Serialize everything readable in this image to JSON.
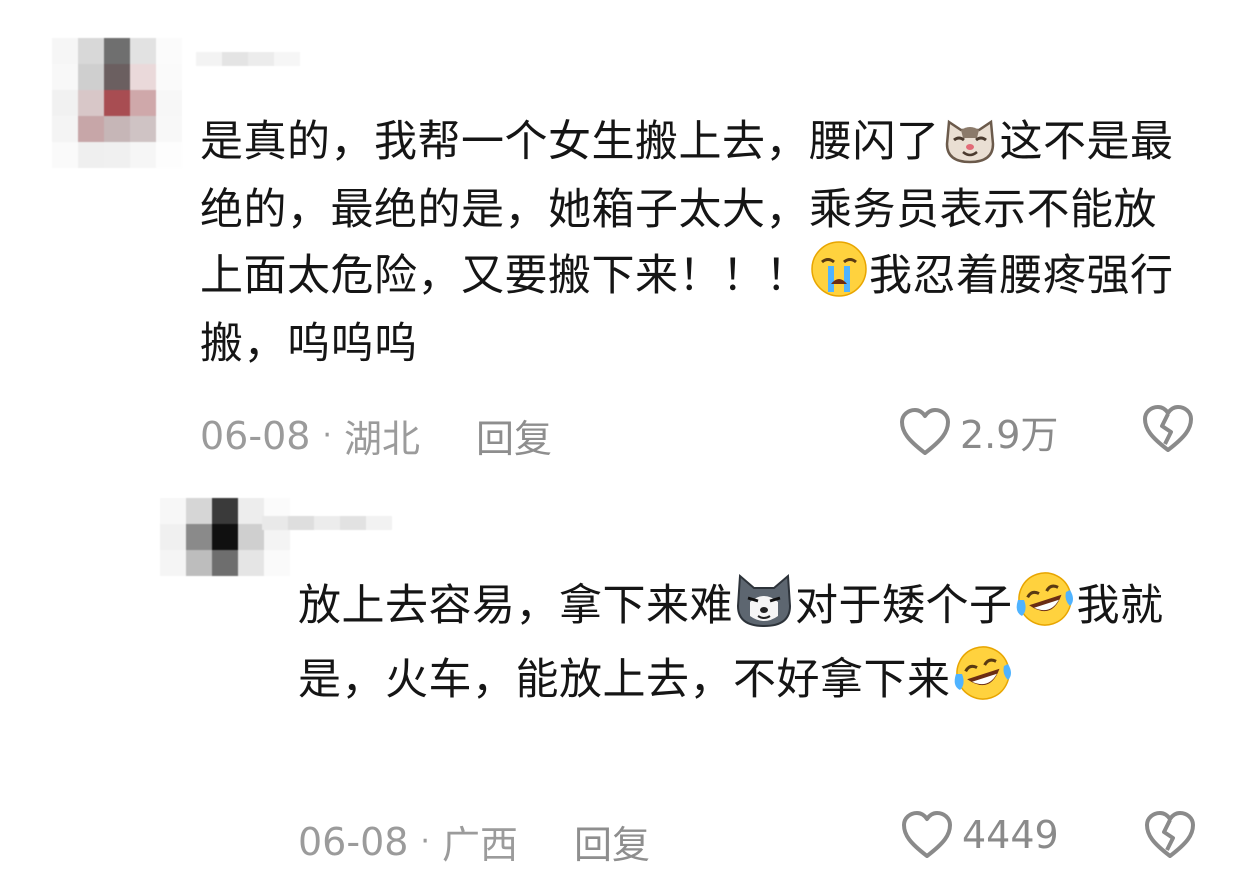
{
  "comments": [
    {
      "segments": [
        {
          "type": "text",
          "value": "是真的，我帮一个女生搬上去，腰闪了"
        },
        {
          "type": "emoji",
          "name": "cat-face-emoji"
        },
        {
          "type": "text",
          "value": "这不是最绝的，最绝的是，她箱子太大，乘务员表示不能放上面太危险，又要搬下来！！！"
        },
        {
          "type": "emoji",
          "name": "crying-face-emoji"
        },
        {
          "type": "text",
          "value": "我忍着腰疼强行搬，呜呜呜"
        }
      ],
      "date": "06-08",
      "location": "湖北",
      "reply_label": "回复",
      "likes": "2.9万"
    },
    {
      "segments": [
        {
          "type": "text",
          "value": "放上去容易，拿下来难"
        },
        {
          "type": "emoji",
          "name": "husky-dog-emoji"
        },
        {
          "type": "text",
          "value": "对于矮个子"
        },
        {
          "type": "emoji",
          "name": "laughing-crying-face-emoji"
        },
        {
          "type": "text",
          "value": "我就是，火车，能放上去，不好拿下来"
        },
        {
          "type": "emoji",
          "name": "laughing-crying-face-emoji"
        }
      ],
      "date": "06-08",
      "location": "广西",
      "reply_label": "回复",
      "likes": "4449"
    }
  ],
  "separator": "·",
  "icons": {
    "like": "heart-outline-icon",
    "dislike": "broken-heart-icon"
  },
  "colors": {
    "text": "#151515",
    "meta": "#9b9b9b"
  }
}
